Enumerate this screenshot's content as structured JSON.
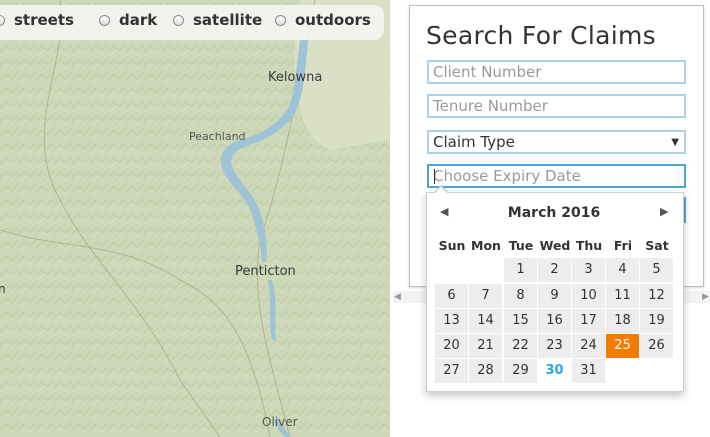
{
  "map": {
    "places": {
      "kelowna": "Kelowna",
      "peachland": "Peachland",
      "penticton": "Penticton",
      "oliver": "Oliver",
      "edge": "n"
    }
  },
  "layers": {
    "streets": "streets",
    "dark": "dark",
    "satellite": "satellite",
    "outdoors": "outdoors"
  },
  "search": {
    "title": "Search For Claims",
    "client_placeholder": "Client Number",
    "tenure_placeholder": "Tenure Number",
    "claim_type": "Claim Type",
    "expiry_placeholder": "Choose Expiry Date"
  },
  "datepicker": {
    "title": "March 2016",
    "weekdays": [
      "Sun",
      "Mon",
      "Tue",
      "Wed",
      "Thu",
      "Fri",
      "Sat"
    ],
    "weeks": [
      [
        "",
        "",
        "1",
        "2",
        "3",
        "4",
        "5"
      ],
      [
        "6",
        "7",
        "8",
        "9",
        "10",
        "11",
        "12"
      ],
      [
        "13",
        "14",
        "15",
        "16",
        "17",
        "18",
        "19"
      ],
      [
        "20",
        "21",
        "22",
        "23",
        "24",
        "25",
        "26"
      ],
      [
        "27",
        "28",
        "29",
        "30",
        "31",
        "",
        ""
      ]
    ],
    "today": "30",
    "selected": "25"
  },
  "icons": {
    "prev": "chevron-left-icon",
    "next": "chevron-right-icon",
    "select": "chevron-down-icon"
  },
  "colors": {
    "accent": "#2fa4e7",
    "selected": "#f57c00",
    "field_border": "#a8d2e8"
  }
}
